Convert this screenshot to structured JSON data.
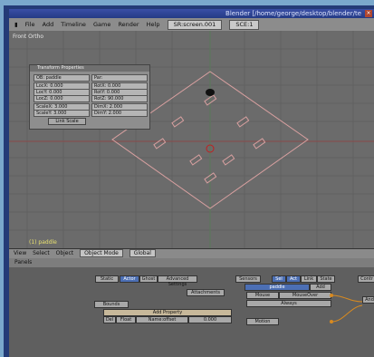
{
  "window": {
    "title": "Blender [/home/george/desktop/blender/te"
  },
  "menubar": {
    "items": [
      "File",
      "Add",
      "Timeline",
      "Game",
      "Render",
      "Help"
    ],
    "screen": "SR:screen.001",
    "scene": "SCE:1"
  },
  "view3d": {
    "label": "Front Ortho",
    "corner_text": "(1) paddle"
  },
  "transform_panel": {
    "title": "Transform Properties",
    "ob_label": "OB: paddle",
    "par_label": "Par:",
    "rows_left": [
      "LocX: 0.000",
      "LocY: 0.000",
      "LocZ: 0.000",
      "ScaleX: 3.000",
      "ScaleY: 3.000",
      "ScaleZ: 3.000"
    ],
    "rows_right": [
      "RotX: 0.000",
      "RotY: 0.000",
      "RotZ: 90.000",
      "DimX: 2.000",
      "DimY: 2.000",
      "DimZ: 2.000"
    ],
    "apply_label": "Link Scale"
  },
  "view_header": {
    "items": [
      "View",
      "Select",
      "Object"
    ],
    "mode": "Object Mode",
    "orientation": "Global"
  },
  "panel_header": {
    "label": "Panels"
  },
  "logic": {
    "static_label": "Static",
    "actor_label": "Actor",
    "ghost_label": "Ghost",
    "adv_label": "Advanced Settings",
    "add_property": "Add Property",
    "prop_row": {
      "del": "Del",
      "type": "Float",
      "name": "Name:offset",
      "value": "0.000"
    },
    "attach_label": "Attachments",
    "bounds_label": "Bounds",
    "sensors_label": "Sensors",
    "sel_label": "Sel",
    "act_label": "Act",
    "link_label": "Link",
    "state_label": "State",
    "obj_name": "paddle",
    "add_label": "Add",
    "mouse_label": "Mouse",
    "mouse_event": "MouseOver",
    "always_label": "Always",
    "motion_label": "Motion",
    "and_label": "And",
    "controller_label": "Contr"
  }
}
